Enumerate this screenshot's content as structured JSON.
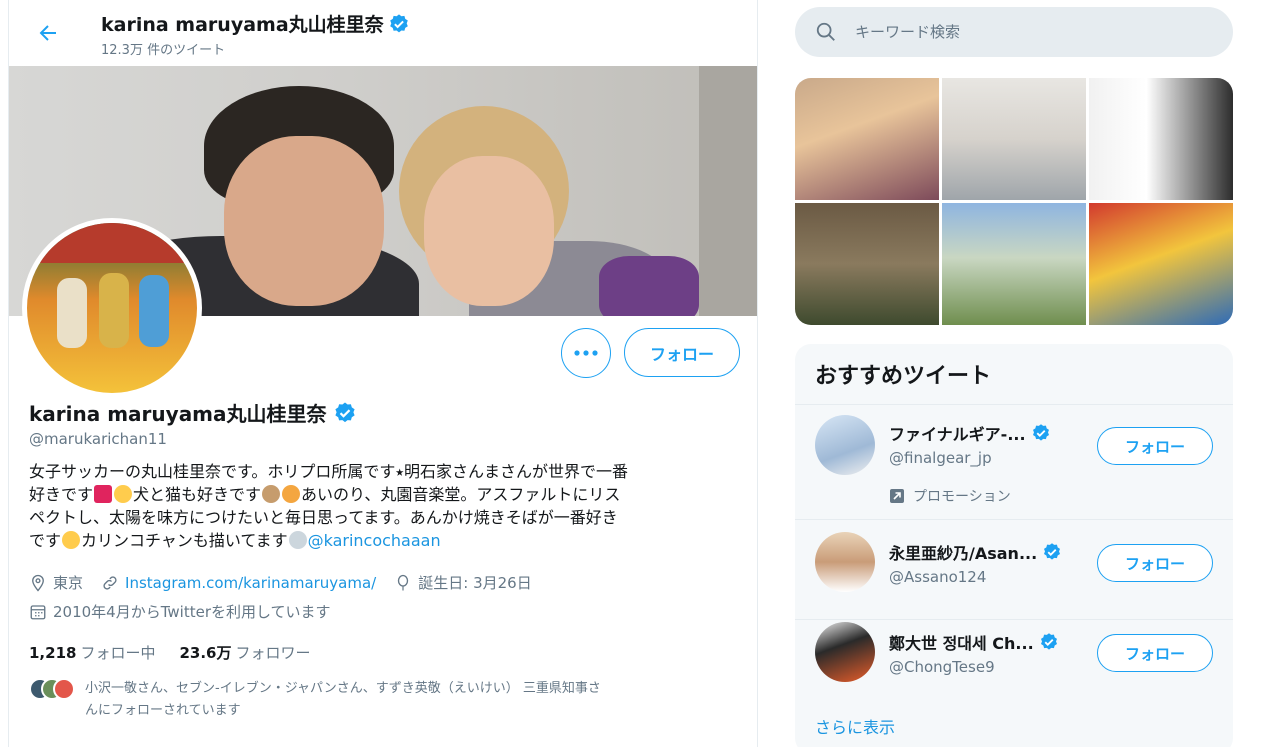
{
  "header": {
    "name": "karina maruyama丸山桂里奈",
    "tweet_count": "12.3万 件のツイート"
  },
  "profile": {
    "name": "karina maruyama丸山桂里奈",
    "handle": "@marukarichan11",
    "follow_label": "フォロー",
    "bio": {
      "line1": "女子サッカーの丸山桂里奈です。ホリプロ所属です⭑明石家さんまさんが世界で一番",
      "line2a": "好きです",
      "line2b": "犬と猫も好きです",
      "line2c": "あいのり、丸園音楽堂。アスファルトにリス",
      "line3": "ペクトし、太陽を味方につけたいと毎日思ってます。あんかけ焼きそばが一番好き",
      "line4a": "です",
      "line4b": "カリンコチャンも描いてます",
      "mention": "@karincochaaan"
    },
    "location": "東京",
    "website": "Instagram.com/karinamaruyama/",
    "birthday": "誕生日: 3月26日",
    "joined": "2010年4月からTwitterを利用しています",
    "following_count": "1,218",
    "following_label": "フォロー中",
    "followers_count": "23.6万",
    "followers_label": "フォロワー",
    "followed_by_line1": "小沢一敬さん、セブン-イレブン・ジャパンさん、すずき英敬（えいけい） 三重県知事さ",
    "followed_by_line2": "んにフォローされています"
  },
  "search": {
    "placeholder": "キーワード検索"
  },
  "suggest": {
    "title": "おすすめツイート",
    "items": [
      {
        "name": "ファイナルギア-...",
        "handle": "@finalgear_jp",
        "follow_label": "フォロー",
        "promo": "プロモーション"
      },
      {
        "name": "永里亜紗乃/Asan...",
        "handle": "@Assano124",
        "follow_label": "フォロー"
      },
      {
        "name": "鄭大世 정대세 Ch...",
        "handle": "@ChongTese9",
        "follow_label": "フォロー"
      }
    ],
    "more": "さらに表示"
  },
  "colors": {
    "accent": "#1da1f2",
    "link": "#1b95e0",
    "muted": "#657786"
  }
}
